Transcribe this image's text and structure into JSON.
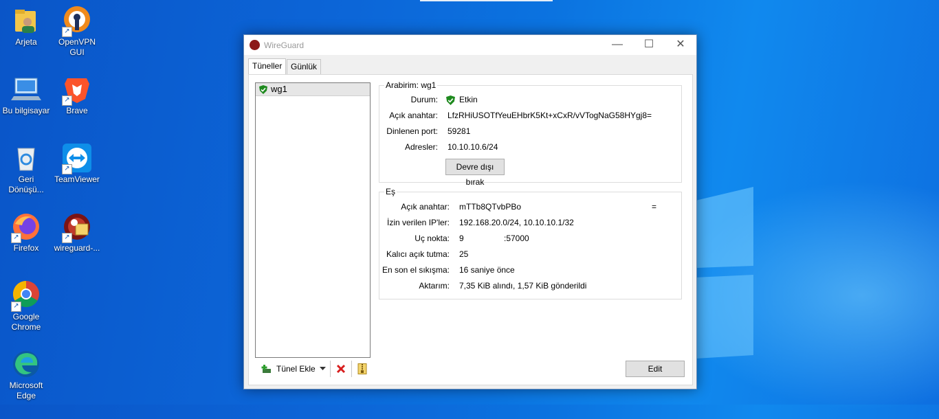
{
  "desktop": {
    "icons": [
      {
        "label": "Arjeta"
      },
      {
        "label": "OpenVPN GUI"
      },
      {
        "label": "Bu bilgisayar"
      },
      {
        "label": "Brave"
      },
      {
        "label": "Geri Dönüşü..."
      },
      {
        "label": "TeamViewer"
      },
      {
        "label": "Firefox"
      },
      {
        "label": "wireguard-..."
      },
      {
        "label": "Google Chrome"
      },
      {
        "label": "Microsoft Edge"
      }
    ]
  },
  "window": {
    "title": "WireGuard",
    "minimize": "—",
    "maximize": "☐",
    "close": "✕",
    "tabs": [
      {
        "label": "Tüneller"
      },
      {
        "label": "Günlük"
      }
    ],
    "tunnels": [
      {
        "name": "wg1",
        "status_color": "#1e8a1e"
      }
    ],
    "toolbar": {
      "add_label": "Tünel Ekle"
    },
    "interface": {
      "legend": "Arabirim: wg1",
      "status_label": "Durum:",
      "status_value": "Etkin",
      "pubkey_label": "Açık anahtar:",
      "pubkey_value": "LfzRHiUSOTfYeuEHbrK5Kt+xCxR/vVTogNaG58HYgj8=",
      "port_label": "Dinlenen port:",
      "port_value": "59281",
      "addr_label": "Adresler:",
      "addr_value": "10.10.10.6/24",
      "deactivate_button": "Devre dışı bırak"
    },
    "peer": {
      "legend": "Eş",
      "pubkey_label": "Açık anahtar:",
      "pubkey_value": "mTTb8QTvbPBo",
      "pubkey_suffix": "=",
      "allowed_label": "İzin verilen IP'ler:",
      "allowed_value": "192.168.20.0/24, 10.10.10.1/32",
      "endpoint_label": "Uç nokta:",
      "endpoint_prefix": "9",
      "endpoint_port": ":57000",
      "keepalive_label": "Kalıcı açık tutma:",
      "keepalive_value": "25",
      "handshake_label": "En son el sıkışma:",
      "handshake_value": "16 saniye önce",
      "transfer_label": "Aktarım:",
      "transfer_value": "7,35 KiB alındı, 1,57 KiB gönderildi"
    },
    "edit_button": "Edit"
  }
}
